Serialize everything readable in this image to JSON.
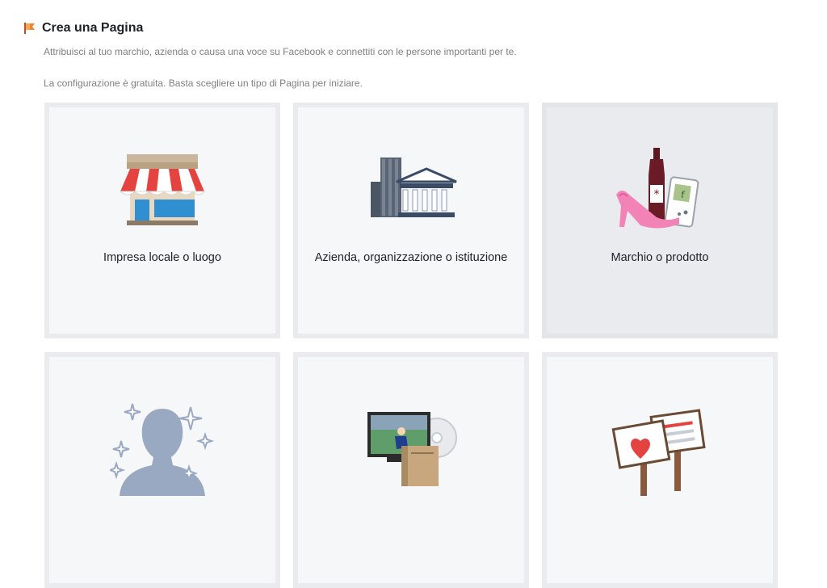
{
  "header": {
    "title": "Crea una Pagina",
    "icon": "flag-icon",
    "description_1": "Attribuisci al tuo marchio, azienda o causa una voce su Facebook e connettiti con le persone importanti per te.",
    "description_2": "La configurazione è gratuita. Basta scegliere un tipo di Pagina per iniziare."
  },
  "page_types": [
    {
      "label": "Impresa locale o luogo",
      "icon": "storefront-icon"
    },
    {
      "label": "Azienda, organizzazione o istituzione",
      "icon": "office-buildings-icon"
    },
    {
      "label": "Marchio o prodotto",
      "icon": "product-collage-icon"
    },
    {
      "label": "",
      "icon": "public-figure-silhouette-icon"
    },
    {
      "label": "",
      "icon": "entertainment-media-icon"
    },
    {
      "label": "",
      "icon": "cause-signs-icon"
    }
  ],
  "colors": {
    "accent_orange": "#f0862b",
    "card_bg": "#f6f7f9",
    "card_border": "#e9ebee",
    "card_hover_bg": "#e9ebee"
  }
}
